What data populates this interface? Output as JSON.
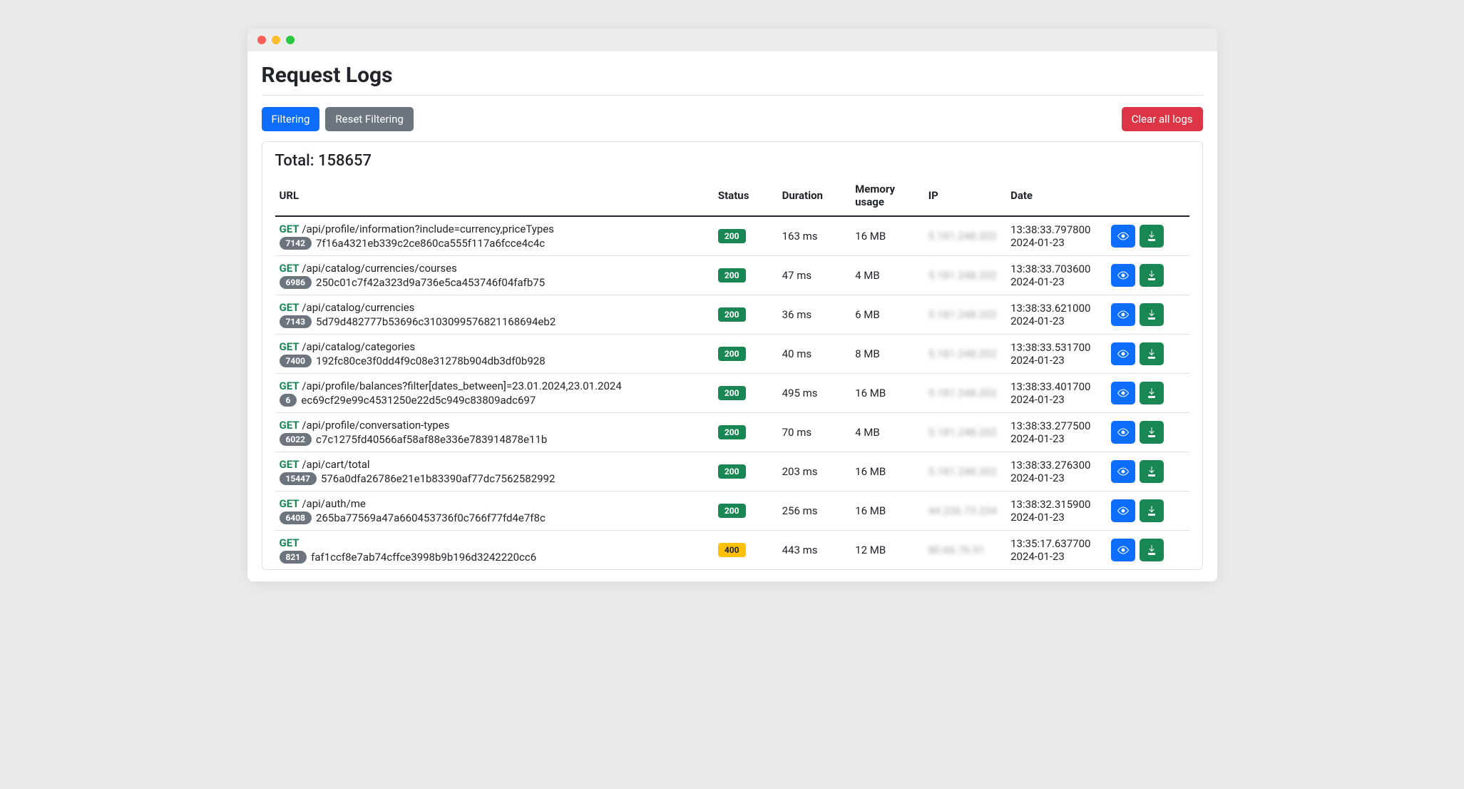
{
  "page": {
    "title": "Request Logs",
    "total_label": "Total: 158657"
  },
  "toolbar": {
    "filtering": "Filtering",
    "reset_filtering": "Reset Filtering",
    "clear_all": "Clear all logs"
  },
  "table": {
    "headers": {
      "url": "URL",
      "status": "Status",
      "duration": "Duration",
      "memory": "Memory usage",
      "ip": "IP",
      "date": "Date"
    }
  },
  "logs": [
    {
      "method": "GET",
      "path": "/api/profile/information?include=currency,priceTypes",
      "count": "7142",
      "hash": "7f16a4321eb339c2ce860ca555f117a6fcce4c4c",
      "status": "200",
      "duration": "163 ms",
      "memory": "16 MB",
      "ip": "5.181.248.202",
      "time": "13:38:33.797800",
      "date": "2024-01-23"
    },
    {
      "method": "GET",
      "path": "/api/catalog/currencies/courses",
      "count": "6986",
      "hash": "250c01c7f42a323d9a736e5ca453746f04fafb75",
      "status": "200",
      "duration": "47 ms",
      "memory": "4 MB",
      "ip": "5.181.248.202",
      "time": "13:38:33.703600",
      "date": "2024-01-23"
    },
    {
      "method": "GET",
      "path": "/api/catalog/currencies",
      "count": "7143",
      "hash": "5d79d482777b53696c3103099576821168694eb2",
      "status": "200",
      "duration": "36 ms",
      "memory": "6 MB",
      "ip": "5.181.248.202",
      "time": "13:38:33.621000",
      "date": "2024-01-23"
    },
    {
      "method": "GET",
      "path": "/api/catalog/categories",
      "count": "7400",
      "hash": "192fc80ce3f0dd4f9c08e31278b904db3df0b928",
      "status": "200",
      "duration": "40 ms",
      "memory": "8 MB",
      "ip": "5.181.248.202",
      "time": "13:38:33.531700",
      "date": "2024-01-23"
    },
    {
      "method": "GET",
      "path": "/api/profile/balances?filter[dates_between]=23.01.2024,23.01.2024",
      "count": "6",
      "hash": "ec69cf29e99c4531250e22d5c949c83809adc697",
      "status": "200",
      "duration": "495 ms",
      "memory": "16 MB",
      "ip": "5.181.248.202",
      "time": "13:38:33.401700",
      "date": "2024-01-23"
    },
    {
      "method": "GET",
      "path": "/api/profile/conversation-types",
      "count": "6022",
      "hash": "c7c1275fd40566af58af88e336e783914878e11b",
      "status": "200",
      "duration": "70 ms",
      "memory": "4 MB",
      "ip": "5.181.248.202",
      "time": "13:38:33.277500",
      "date": "2024-01-23"
    },
    {
      "method": "GET",
      "path": "/api/cart/total",
      "count": "15447",
      "hash": "576a0dfa26786e21e1b83390af77dc7562582992",
      "status": "200",
      "duration": "203 ms",
      "memory": "16 MB",
      "ip": "5.181.248.202",
      "time": "13:38:33.276300",
      "date": "2024-01-23"
    },
    {
      "method": "GET",
      "path": "/api/auth/me",
      "count": "6408",
      "hash": "265ba77569a47a660453736f0c766f77fd4e7f8c",
      "status": "200",
      "duration": "256 ms",
      "memory": "16 MB",
      "ip": "44.226.73.234",
      "time": "13:38:32.315900",
      "date": "2024-01-23"
    },
    {
      "method": "GET",
      "path": "",
      "count": "821",
      "hash": "faf1ccf8e7ab74cffce3998b9b196d3242220cc6",
      "status": "400",
      "duration": "443 ms",
      "memory": "12 MB",
      "ip": "80.66.76.91",
      "time": "13:35:17.637700",
      "date": "2024-01-23"
    }
  ]
}
